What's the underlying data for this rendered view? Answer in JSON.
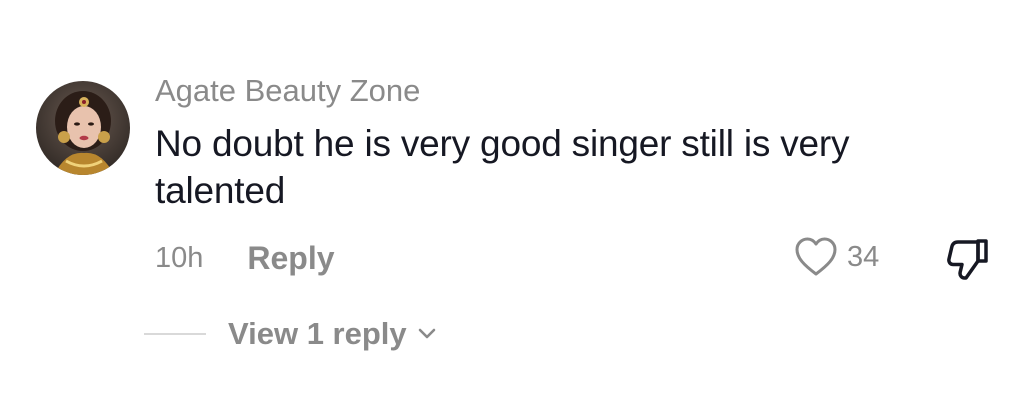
{
  "comment": {
    "author": "Agate Beauty Zone",
    "text": "No doubt he is very good singer still is very talented",
    "time": "10h",
    "reply_label": "Reply",
    "like_count": "34",
    "view_replies_label": "View 1 reply",
    "icons": {
      "like": "heart-icon",
      "dislike": "thumbs-down-icon",
      "expand": "chevron-down-icon"
    }
  },
  "colors": {
    "muted_text": "#8a8a8a",
    "primary_text": "#161823",
    "divider": "#d9d9d9"
  }
}
